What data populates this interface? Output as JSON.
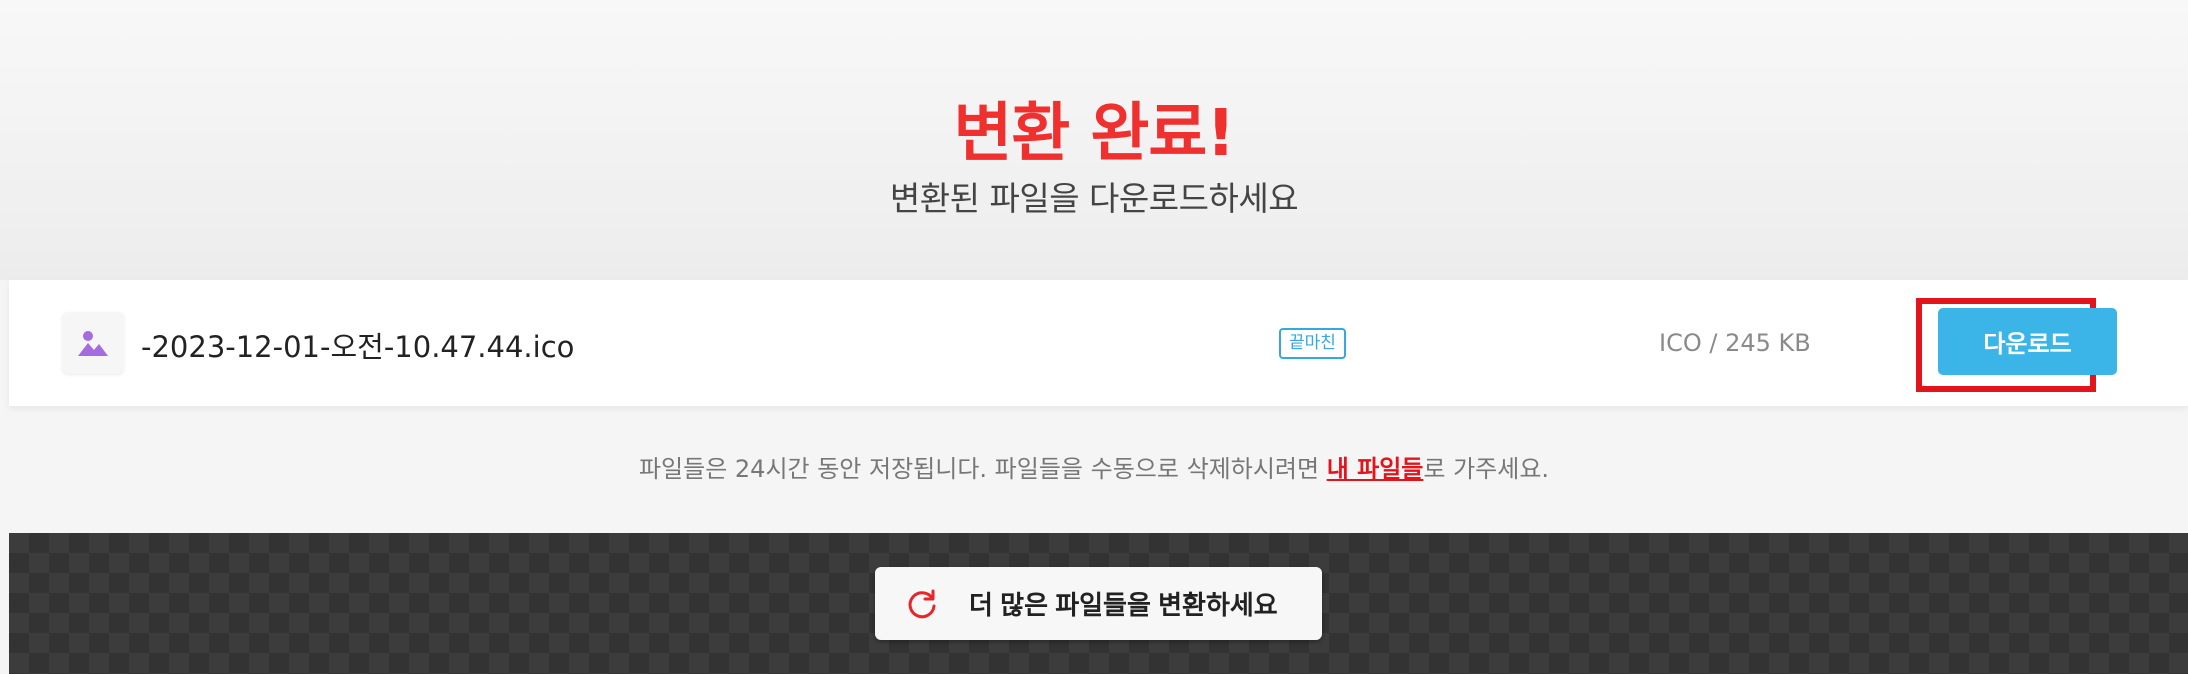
{
  "header": {
    "title": "변환 완료!",
    "subtitle": "변환된 파일을 다운로드하세요"
  },
  "file": {
    "name": "-2023-12-01-오전-10.47.44.ico",
    "status": "끝마친",
    "meta": "ICO / 245 KB",
    "download_label": "다운로드",
    "icon": "image-icon"
  },
  "notice": {
    "text_before": "파일들은 24시간 동안 저장됩니다. 파일들을 수동으로 삭제하시려면 ",
    "link": "내 파일들",
    "text_after": "로 가주세요."
  },
  "more": {
    "label": "더 많은 파일들을 변환하세요",
    "icon": "refresh-icon"
  },
  "colors": {
    "accent_red": "#f0302f",
    "download_blue": "#3bb4e8",
    "badge_blue": "#36a8e0"
  }
}
